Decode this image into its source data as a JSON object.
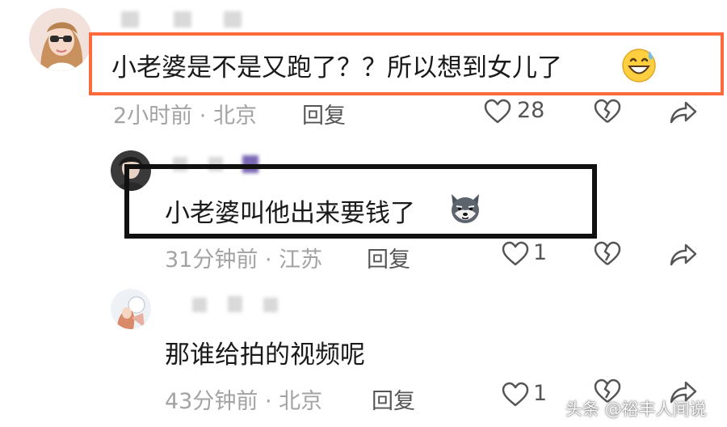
{
  "comments": [
    {
      "text": "小老婆是不是又跑了？？所以想到女儿了",
      "emoji": "grinning-sweat-emoji",
      "time": "2小时前",
      "location": "北京",
      "reply_label": "回复",
      "likes": "28"
    },
    {
      "text": "小老婆叫他出来要钱了",
      "emoji": "dog-emoji",
      "time": "31分钟前",
      "location": "江苏",
      "reply_label": "回复",
      "likes": "1"
    },
    {
      "text": "那谁给拍的视频呢",
      "time": "43分钟前",
      "location": "北京",
      "reply_label": "回复",
      "likes": "1"
    }
  ],
  "separator": "·",
  "watermark": "头条 @裕丰人间说",
  "colors": {
    "highlight_orange": "#ff6a3c",
    "highlight_black": "#111111",
    "meta_gray": "#a3a3a3"
  },
  "icons": [
    "heart-icon",
    "broken-heart-icon",
    "share-icon"
  ]
}
